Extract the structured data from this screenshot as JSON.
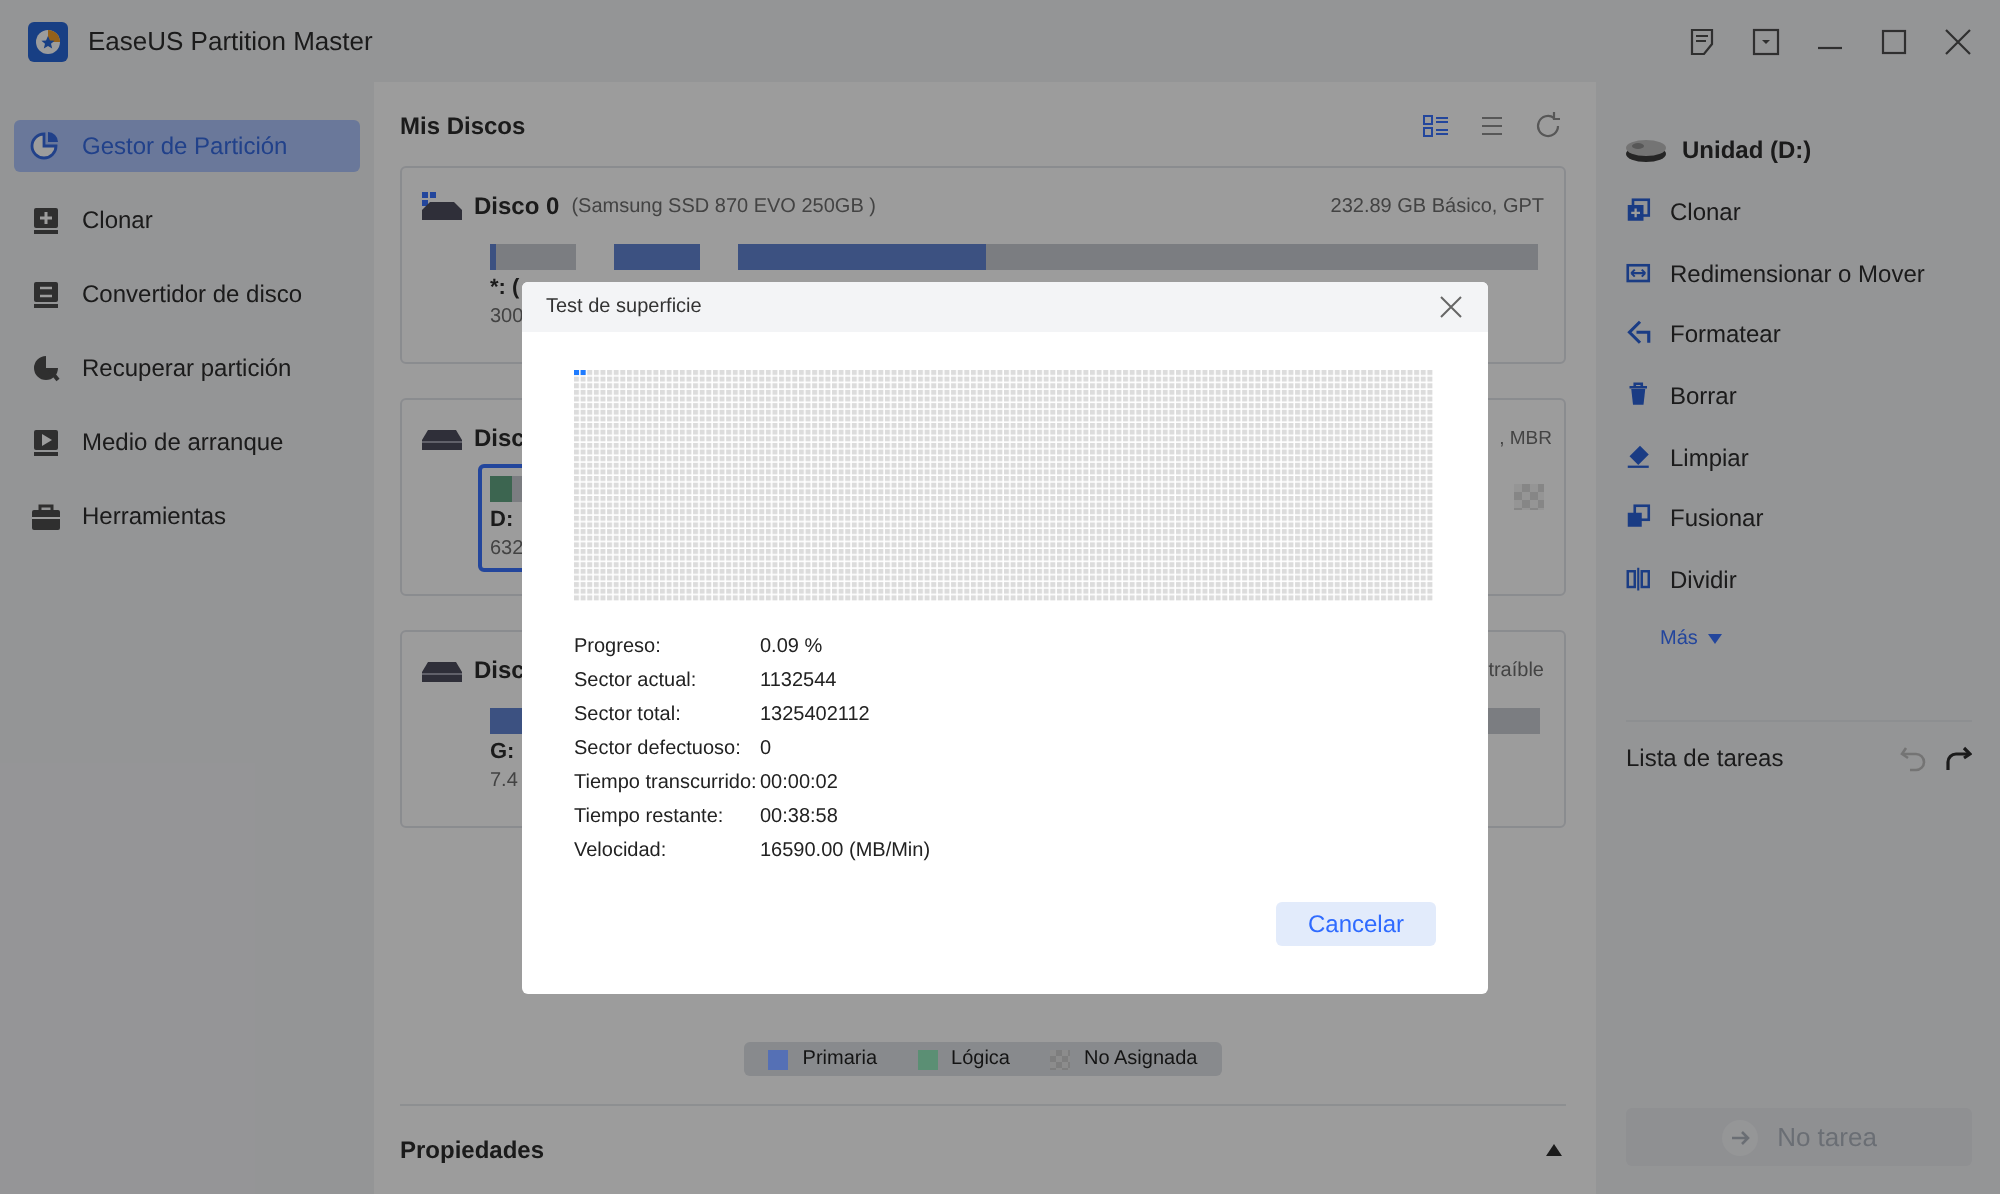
{
  "window": {
    "title": "EaseUS Partition Master"
  },
  "sidebar": {
    "items": [
      {
        "label": "Gestor de Partición",
        "selected": true
      },
      {
        "label": "Clonar",
        "selected": false
      },
      {
        "label": "Convertidor de disco",
        "selected": false
      },
      {
        "label": "Recuperar partición",
        "selected": false
      },
      {
        "label": "Medio de arranque",
        "selected": false
      },
      {
        "label": "Herramientas",
        "selected": false
      }
    ]
  },
  "main": {
    "title": "Mis Discos",
    "disks": [
      {
        "name": "Disco 0",
        "model": "(Samsung SSD 870 EVO 250GB )",
        "info": "232.89 GB Básico, GPT",
        "partitions": [
          {
            "kind": "primary",
            "level": 0.08,
            "label": "*: (",
            "size": "300"
          },
          {
            "kind": "primary",
            "level": 1
          },
          {
            "kind": "primary",
            "level": 0.31
          }
        ]
      },
      {
        "name": "Disc",
        "info": ", MBR",
        "partitions": [
          {
            "kind": "logical",
            "level": 0.5,
            "selected": true,
            "label": "D:",
            "size": "632"
          },
          {
            "kind": "gap"
          },
          {
            "kind": "unallocated"
          }
        ]
      },
      {
        "name": "Disc",
        "info": "traíble",
        "partitions": [
          {
            "kind": "primary",
            "level": 0.5,
            "label": "G:",
            "size": "7.4"
          }
        ]
      }
    ],
    "legend": [
      {
        "kind": "primary",
        "label": "Primaria",
        "color": "#5570b5"
      },
      {
        "kind": "logical",
        "label": "Lógica",
        "color": "#5b8f74"
      },
      {
        "kind": "unallocated",
        "label": "No Asignada"
      }
    ],
    "properties": {
      "title": "Propiedades",
      "expanded": true
    }
  },
  "right_panel": {
    "drive": "Unidad (D:)",
    "actions": [
      {
        "label": "Clonar"
      },
      {
        "label": "Redimensionar o Mover"
      },
      {
        "label": "Formatear"
      },
      {
        "label": "Borrar"
      },
      {
        "label": "Limpiar"
      },
      {
        "label": "Fusionar"
      },
      {
        "label": "Dividir"
      }
    ],
    "more": "Más",
    "task_list": "Lista de tareas",
    "undo_disabled": true,
    "redo_disabled": false,
    "run_button": {
      "label": "No tarea",
      "disabled": true
    }
  },
  "dialog": {
    "title": "Test de superficie",
    "scan": {
      "level": 0.0004
    },
    "fields": [
      {
        "label": "Progreso:",
        "value": "0.09 %"
      },
      {
        "label": "Sector actual:",
        "value": "1132544"
      },
      {
        "label": "Sector total:",
        "value": "1325402112"
      },
      {
        "label": "Sector defectuoso:",
        "value": "0"
      },
      {
        "label": "Tiempo transcurrido:",
        "value": "00:00:02"
      },
      {
        "label": "Tiempo restante:",
        "value": "00:38:58"
      },
      {
        "label": "Velocidad:",
        "value": "16590.00 (MB/Min)"
      }
    ],
    "button": "Cancelar"
  }
}
